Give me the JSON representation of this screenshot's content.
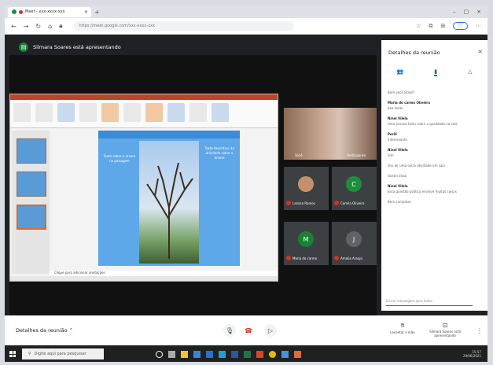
{
  "browser": {
    "tab_title": "Meet - xxx-xxxx-xxx",
    "url": "https://meet.google.com/xxx-xxxx-xxx"
  },
  "presenter_banner": "Silmara Soares está apresentando",
  "slide": {
    "left_text": "Texto sobre a árvore na paisagem",
    "right_text": "Texto descritivo da atividade sobre a árvore",
    "notes": "Clique para adicionar anotações"
  },
  "camera": {
    "left_name": "Você",
    "right_name": "Participante"
  },
  "participants": [
    {
      "name": "Larissa Ramos",
      "initial": "",
      "color": "#c58f6b"
    },
    {
      "name": "Camila Oliveira",
      "initial": "C",
      "color": "#1e8e3e"
    },
    {
      "name": "Maria do carmo",
      "initial": "M",
      "color": "#188038"
    },
    {
      "name": "Amalia Araujo",
      "initial": "J",
      "color": "#5f6368"
    }
  ],
  "panel": {
    "title": "Detalhes da reunião",
    "close": "×",
    "tabs": [
      "👥",
      "▮",
      "△"
    ],
    "messages": [
      {
        "who": "",
        "text": "Bom você Brasil?"
      },
      {
        "who": "Maria do carmo Oliveira",
        "text": "boa tarde"
      },
      {
        "who": "Ninel Vilela",
        "text": "Uma pessoa falou sobre a qualidade na sala"
      },
      {
        "who": "Perili",
        "text": "Interessante"
      },
      {
        "who": "Ninel Vilela",
        "text": "Sim"
      },
      {
        "who": "",
        "text": "Vou ler uma outra atividade em sala"
      },
      {
        "who": "",
        "text": "Gostei disso"
      },
      {
        "who": "Ninel Vilela",
        "text": "Essa questão política envolve muitas coisas"
      },
      {
        "who": "",
        "text": "Bem complexo"
      }
    ],
    "input_placeholder": "Enviar mensagem para todos"
  },
  "bottom": {
    "details_label": "Detalhes da reunião",
    "chevron": "⌃",
    "raise_hand": "Levantar a mão",
    "stop_presenting": "Silmara Soares está apresentando",
    "more": "⋮"
  },
  "taskbar": {
    "search_placeholder": "Digite aqui para pesquisar",
    "time": "15:57",
    "date": "29/06/2021"
  }
}
